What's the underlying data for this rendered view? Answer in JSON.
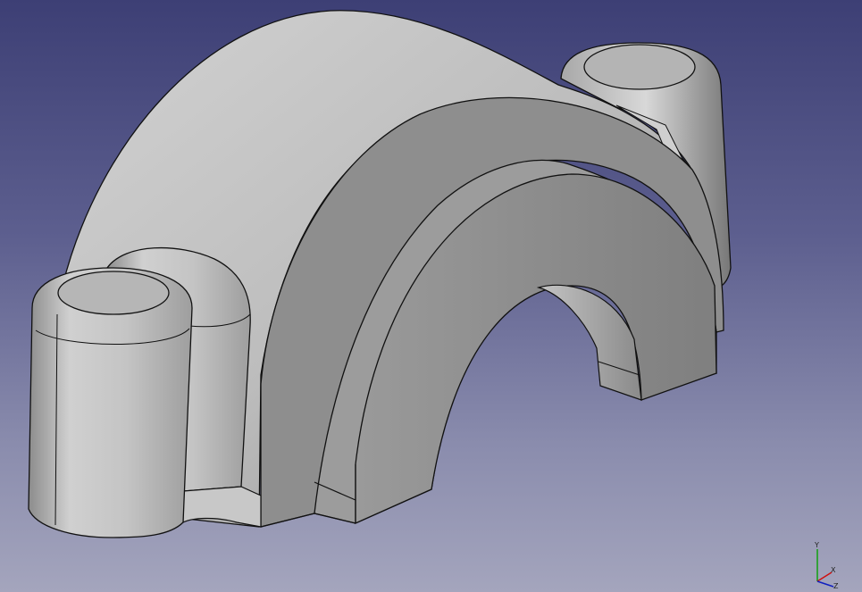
{
  "viewport": {
    "background_top": "#3d3f75",
    "background_bottom": "#a4a5bd",
    "model_color": "#bdbdbd",
    "edge_color": "#111111"
  },
  "axis": {
    "x_label": "X",
    "y_label": "Y",
    "z_label": "Z",
    "x_color": "#d01010",
    "y_color": "#10a010",
    "z_color": "#1020c0"
  }
}
